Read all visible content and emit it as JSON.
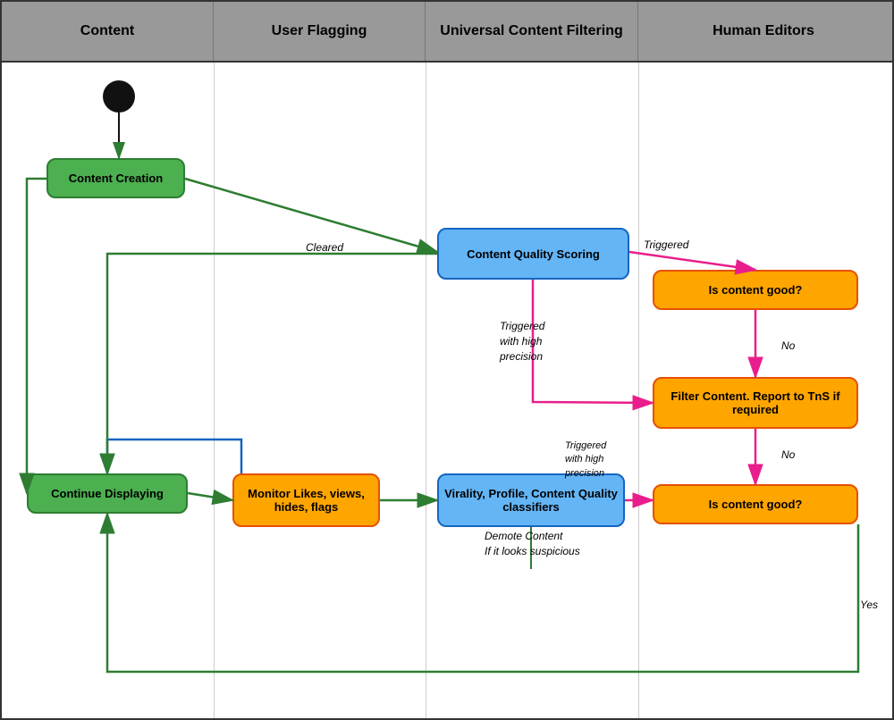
{
  "header": {
    "columns": [
      "Content",
      "User Flagging",
      "Universal Content Filtering",
      "Human Editors"
    ]
  },
  "nodes": {
    "start_circle": {
      "label": ""
    },
    "content_creation": {
      "label": "Content Creation"
    },
    "content_quality_scoring": {
      "label": "Content Quality Scoring"
    },
    "is_content_good_1": {
      "label": "Is content good?"
    },
    "filter_content": {
      "label": "Filter Content. Report to TnS if required"
    },
    "is_content_good_2": {
      "label": "Is content good?"
    },
    "monitor_likes": {
      "label": "Monitor Likes, views, hides, flags"
    },
    "virality": {
      "label": "Virality, Profile, Content Quality classifiers"
    },
    "continue_displaying": {
      "label": "Continue Displaying"
    }
  },
  "arrow_labels": {
    "cleared": "Cleared",
    "triggered": "Triggered",
    "triggered_high_precision": "Triggered with high precision",
    "triggered_high_precision_2": "Triggered with high precision",
    "no_1": "No",
    "no_2": "No",
    "yes": "Yes",
    "demote_content": "Demote Content\nIf it looks suspicious"
  },
  "colors": {
    "green": "#4CAF50",
    "green_border": "#2e7d32",
    "orange": "#FFA500",
    "orange_border": "#e65100",
    "blue": "#64B5F6",
    "blue_border": "#1565c0",
    "pink": "#E91E8C",
    "dark_green": "#2e7d32",
    "dark_blue": "#1565c0"
  }
}
